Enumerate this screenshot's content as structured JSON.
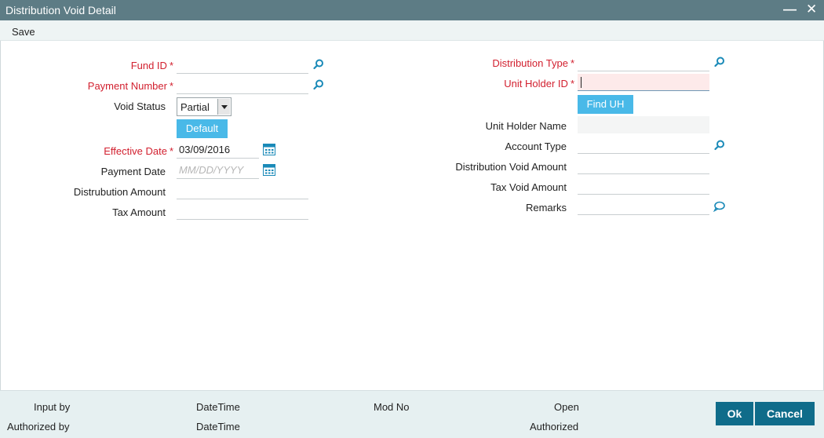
{
  "window": {
    "title": "Distribution Void Detail"
  },
  "menu": {
    "save_label": "Save"
  },
  "left": {
    "fund_id": {
      "label": "Fund ID",
      "value": ""
    },
    "payment_number": {
      "label": "Payment Number",
      "value": ""
    },
    "void_status": {
      "label": "Void Status",
      "selected": "Partial"
    },
    "default_button": "Default",
    "effective_date": {
      "label": "Effective Date",
      "value": "03/09/2016"
    },
    "payment_date": {
      "label": "Payment Date",
      "value": "",
      "placeholder": "MM/DD/YYYY"
    },
    "distribution_amount": {
      "label": "Distrubution Amount",
      "value": ""
    },
    "tax_amount": {
      "label": "Tax Amount",
      "value": ""
    }
  },
  "right": {
    "distribution_type": {
      "label": "Distribution Type",
      "value": ""
    },
    "unit_holder_id": {
      "label": "Unit Holder ID",
      "value": ""
    },
    "find_uh_button": "Find UH",
    "unit_holder_name": {
      "label": "Unit Holder Name",
      "value": ""
    },
    "account_type": {
      "label": "Account Type",
      "value": ""
    },
    "distribution_void_amount": {
      "label": "Distribution Void Amount",
      "value": ""
    },
    "tax_void_amount": {
      "label": "Tax Void Amount",
      "value": ""
    },
    "remarks": {
      "label": "Remarks",
      "value": ""
    }
  },
  "required_marker": "*",
  "footer": {
    "input_by": "Input by",
    "authorized_by": "Authorized by",
    "datetime_1": "DateTime",
    "datetime_2": "DateTime",
    "mod_no": "Mod No",
    "open": "Open",
    "authorized": "Authorized",
    "ok_label": "Ok",
    "cancel_label": "Cancel"
  },
  "icons": {
    "search": "search-icon",
    "calendar": "calendar-icon",
    "comment": "speech-bubble-icon",
    "minimize": "minimize-icon",
    "close": "close-icon"
  },
  "colors": {
    "titlebar": "#5d7c85",
    "required_label": "#d2202f",
    "accent_button": "#49b9e8",
    "primary_button": "#0f6c8a",
    "icon": "#1a8ab8",
    "focused_field": "#fdeaea"
  }
}
